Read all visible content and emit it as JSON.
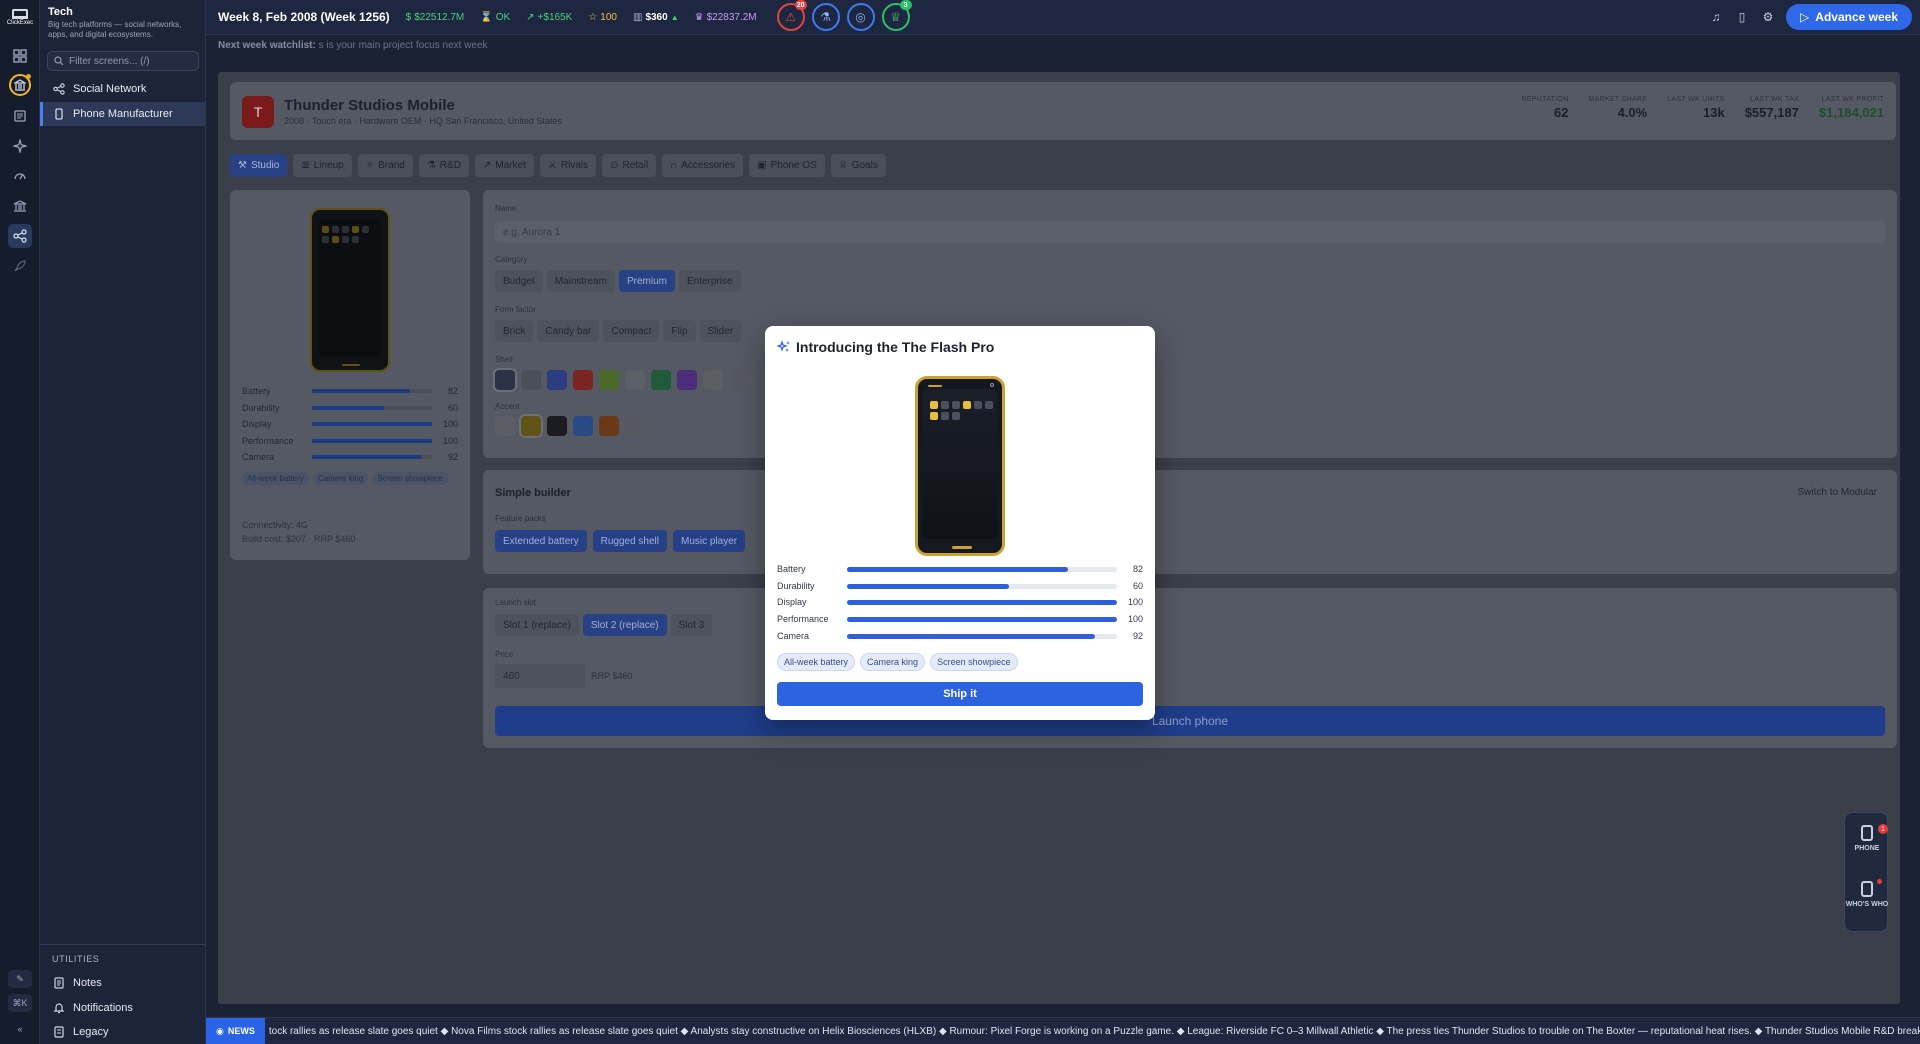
{
  "app": {
    "logo_text": "ClickExec",
    "section_title": "Tech",
    "section_sub": "Big tech platforms — social networks, apps, and digital ecosystems."
  },
  "nav": {
    "filter_placeholder": "Filter screens... (/)",
    "items": [
      {
        "label": "Social Network"
      },
      {
        "label": "Phone Manufacturer"
      }
    ],
    "utilities_heading": "UTILITIES",
    "utilities": [
      {
        "label": "Notes"
      },
      {
        "label": "Notifications"
      },
      {
        "label": "Legacy"
      }
    ],
    "shortcut_label": "⌘K"
  },
  "topbar": {
    "week": "Week 8, Feb 2008 (Week 1256)",
    "cash": "$22512.7M",
    "status": "OK",
    "delta": "+$165K",
    "rating": "100",
    "price": "$360",
    "networth": "$22837.2M",
    "alert_count": "20",
    "goals_count": "3",
    "advance_label": "Advance week",
    "colors": {
      "cash": "#4cd07d",
      "rating": "#f2c14b",
      "networth": "#c69bf5",
      "alert": "#e5433f",
      "blue": "#3f7af0",
      "green": "#2fc06a"
    }
  },
  "watchlist": {
    "prefix": "Next week watchlist:",
    "text": "s is your main project focus next week"
  },
  "company": {
    "initial": "T",
    "name": "Thunder Studios Mobile",
    "sub": "2008 · Touch era · Hardware OEM · HQ San Francisco, United States",
    "kpis": [
      {
        "label": "REPUTATION",
        "value": "62"
      },
      {
        "label": "MARKET SHARE",
        "value": "4.0%"
      },
      {
        "label": "LAST WK UNITS",
        "value": "13k"
      },
      {
        "label": "LAST WK TAX",
        "value": "$557,187"
      },
      {
        "label": "LAST WK PROFIT",
        "value": "$1,184,021"
      }
    ]
  },
  "tabs": [
    {
      "label": "Studio"
    },
    {
      "label": "Lineup"
    },
    {
      "label": "Brand"
    },
    {
      "label": "R&D"
    },
    {
      "label": "Market"
    },
    {
      "label": "Rivals"
    },
    {
      "label": "Retail"
    },
    {
      "label": "Accessories"
    },
    {
      "label": "Phone OS"
    },
    {
      "label": "Goals"
    }
  ],
  "specs": [
    {
      "label": "Battery",
      "value": 82
    },
    {
      "label": "Durability",
      "value": 60
    },
    {
      "label": "Display",
      "value": 100
    },
    {
      "label": "Performance",
      "value": 100
    },
    {
      "label": "Camera",
      "value": 92
    }
  ],
  "traits": [
    "All-week battery",
    "Camera king",
    "Screen showpiece"
  ],
  "phone_card": {
    "connectivity": "Connectivity: 4G",
    "build": "Build cost: $207 · RRP $460"
  },
  "form": {
    "name_label": "Name",
    "name_placeholder": "e.g. Aurora 1",
    "category_label": "Category",
    "categories": [
      "Budget",
      "Mainstream",
      "Premium",
      "Enterprise"
    ],
    "form_factor_label": "Form factor",
    "form_factors": [
      "Brick",
      "Candy bar",
      "Compact",
      "Flip",
      "Slider"
    ],
    "shell_label": "Shell",
    "accent_label": "Accent",
    "shell_colors": [
      "#2b3246",
      "#4a4f5a",
      "#2b3c80",
      "#7a2424",
      "#4b6a2a",
      "#5b5f66",
      "#1f5a3c",
      "#4b2d7a",
      "#5c5e63",
      "#55585f"
    ],
    "accent_colors": [
      "#5b5e64",
      "#5f5416",
      "#1a1c22",
      "#2a4a86",
      "#6a3a18",
      "#55585e"
    ]
  },
  "builder": {
    "title": "Simple builder",
    "switch_label": "Switch to Modular",
    "packs_label": "Feature packs",
    "packs": [
      "Extended battery",
      "Rugged shell",
      "Music player"
    ]
  },
  "launch": {
    "slot_label": "Launch slot",
    "slots": [
      "Slot 1 (replace)",
      "Slot 2 (replace)",
      "Slot 3"
    ],
    "price_label": "Price",
    "price_value": "460",
    "rrp": "RRP $460",
    "button": "Launch phone"
  },
  "modal": {
    "title": "Introducing the The Flash Pro",
    "ship_label": "Ship it"
  },
  "dock": {
    "phone_label": "PHONE",
    "phone_badge": "1",
    "who_label": "WHO'S WHO"
  },
  "news": {
    "tag": "NEWS",
    "text": "tock rallies as release slate goes quiet ◆ Nova Films stock rallies as release slate goes quiet ◆ Analysts stay constructive on Helix Biosciences (HLXB) ◆ Rumour: Pixel Forge is working on a Puzzle game. ◆ League: Riverside FC 0–3 Millwall Athletic ◆ The press ties Thunder Studios to trouble on The Boxter — reputational heat rises. ◆ Thunder Studios Mobile R&D breakthrough: Capa"
  }
}
